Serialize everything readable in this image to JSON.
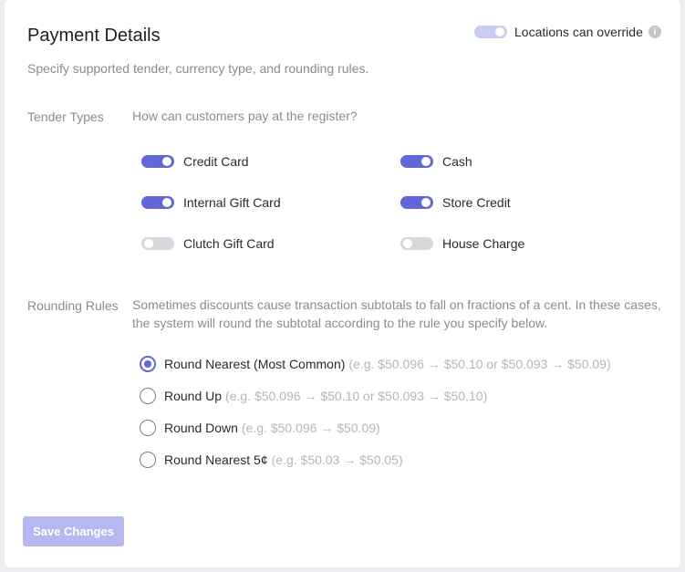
{
  "header": {
    "title": "Payment Details",
    "subtitle": "Specify supported tender, currency type, and rounding rules.",
    "override_label": "Locations can override",
    "override_on": true,
    "info_icon": "i"
  },
  "tender": {
    "label": "Tender Types",
    "question": "How can customers pay at the register?",
    "items": [
      {
        "label": "Credit Card",
        "on": true
      },
      {
        "label": "Cash",
        "on": true
      },
      {
        "label": "Internal Gift Card",
        "on": true
      },
      {
        "label": "Store Credit",
        "on": true
      },
      {
        "label": "Clutch Gift Card",
        "on": false
      },
      {
        "label": "House Charge",
        "on": false
      }
    ]
  },
  "rounding": {
    "label": "Rounding Rules",
    "description": "Sometimes discounts cause transaction subtotals to fall on fractions of a cent. In these cases, the system will round the subtotal according to the rule you specify below.",
    "options": [
      {
        "label": "Round Nearest (Most Common)",
        "example": "(e.g. $50.096 → $50.10 or $50.093 → $50.09)",
        "selected": true
      },
      {
        "label": "Round Up",
        "example": "(e.g. $50.096 → $50.10 or $50.093 → $50.10)",
        "selected": false
      },
      {
        "label": "Round Down",
        "example": "(e.g. $50.096 → $50.09)",
        "selected": false
      },
      {
        "label": "Round Nearest 5¢",
        "example": "(e.g. $50.03 → $50.05)",
        "selected": false
      }
    ]
  },
  "save_label": "Save Changes",
  "colors": {
    "accent": "#6366d9",
    "disabled_button": "#b6b8f0"
  }
}
